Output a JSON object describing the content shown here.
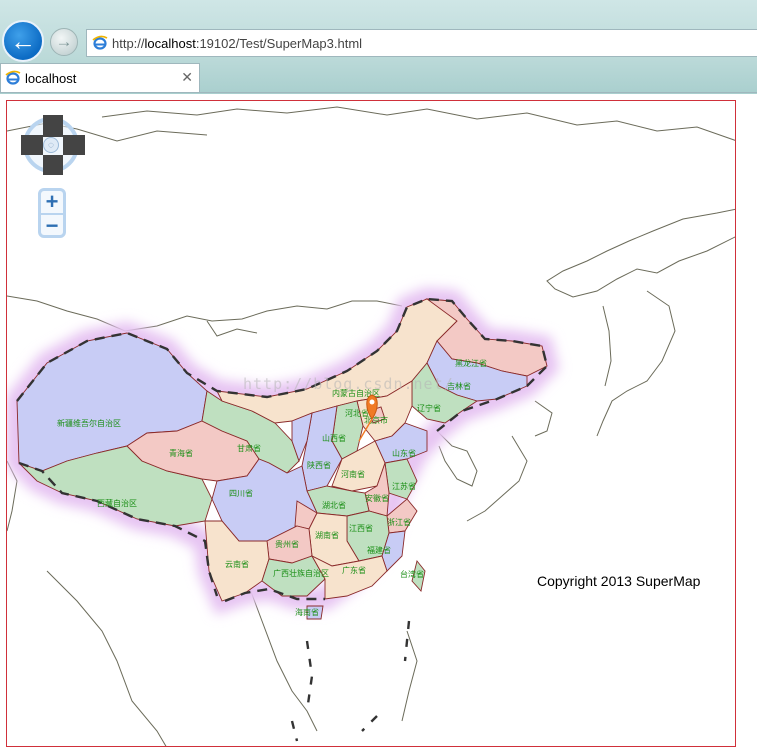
{
  "browser": {
    "url_prefix": "http://",
    "url_host": "localhost",
    "url_rest": ":19102/Test/SuperMap3.html",
    "tab_title": "localhost",
    "tab_close": "✕",
    "back_glyph": "←",
    "forward_glyph": "→"
  },
  "map": {
    "copyright": "Copyright 2013 SuperMap",
    "watermark": "http://blog.csdn.net/",
    "zoom_in": "+",
    "zoom_out": "−",
    "marker_color": "#f07a24",
    "border_glow_color": "#e6c3f2",
    "provinces": [
      {
        "name": "新疆维吾尔自治区",
        "color": "#c8ccf5"
      },
      {
        "name": "西藏自治区",
        "color": "#bfe0c0"
      },
      {
        "name": "青海省",
        "color": "#f3c9c5"
      },
      {
        "name": "内蒙古自治区",
        "color": "#f7e3cd"
      },
      {
        "name": "黑龙江省",
        "color": "#f3c9c5"
      },
      {
        "name": "吉林省",
        "color": "#c8ccf5"
      },
      {
        "name": "辽宁省",
        "color": "#bfe0c0"
      },
      {
        "name": "四川省",
        "color": "#c8ccf5"
      },
      {
        "name": "云南省",
        "color": "#f7e3cd"
      },
      {
        "name": "贵州省",
        "color": "#f3c9c5"
      },
      {
        "name": "广西壮族自治区",
        "color": "#bfe0c0"
      },
      {
        "name": "广东省",
        "color": "#f7e3cd"
      },
      {
        "name": "湖南省",
        "color": "#f7e3cd"
      },
      {
        "name": "湖北省",
        "color": "#bfe0c0"
      },
      {
        "name": "河南省",
        "color": "#f7e3cd"
      },
      {
        "name": "山东省",
        "color": "#c8ccf5"
      },
      {
        "name": "江西省",
        "color": "#bfe0c0"
      },
      {
        "name": "福建省",
        "color": "#c8ccf5"
      },
      {
        "name": "浙江省",
        "color": "#f3c9c5"
      },
      {
        "name": "安徽省",
        "color": "#f3c9c5"
      },
      {
        "name": "江苏省",
        "color": "#bfe0c0"
      },
      {
        "name": "陕西省",
        "color": "#c8ccf5"
      },
      {
        "name": "甘肃省",
        "color": "#bfe0c0"
      },
      {
        "name": "山西省",
        "color": "#bfe0c0"
      },
      {
        "name": "河北省",
        "color": "#f7e3cd"
      },
      {
        "name": "北京市",
        "color": "#f3c9c5"
      },
      {
        "name": "台湾省",
        "color": "#bfe0c0"
      },
      {
        "name": "海南省",
        "color": "#c8ccf5"
      }
    ]
  }
}
